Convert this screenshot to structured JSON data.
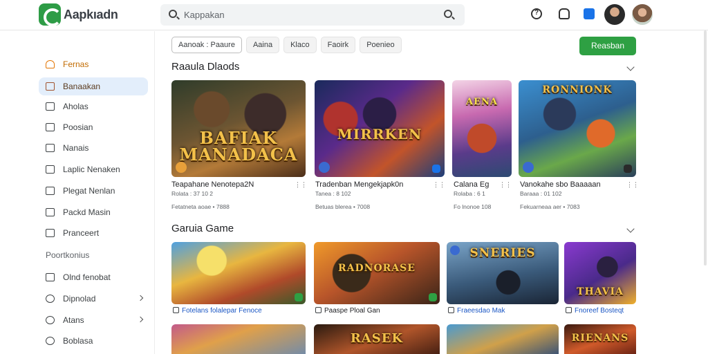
{
  "app": {
    "name": "Aapkıadn"
  },
  "search": {
    "placeholder": "Kappakan"
  },
  "sidebar": {
    "items": [
      {
        "label": "Fernas"
      },
      {
        "label": "Banaakan"
      },
      {
        "label": "Aholas"
      },
      {
        "label": "Poosian"
      },
      {
        "label": "Nanais"
      },
      {
        "label": "Laplic Nenaken"
      },
      {
        "label": "Plegat Nenlan"
      },
      {
        "label": "Packd Masin"
      },
      {
        "label": "Pranceert"
      }
    ],
    "section": "Poortkonius",
    "items2": [
      {
        "label": "Olnd fenobat"
      },
      {
        "label": "Dipnolad"
      },
      {
        "label": "Atans"
      },
      {
        "label": "Boblasa"
      }
    ]
  },
  "chips": [
    "Aanoak : Paaure",
    "Aaina",
    "Klaco",
    "Faoirk",
    "Poenieo"
  ],
  "cta": "Reasban",
  "section1": {
    "title": "Raaula Dlaods",
    "cards": [
      {
        "art": "BAFIAK MANADACA",
        "title": "Teapahane Nenotepa2N",
        "line2": "Rolata : 37 10 2",
        "line3": "Fetatneta aoae • 7888"
      },
      {
        "art": "MIRRKEN",
        "title": "Tradenban Mengekjapk0n",
        "line2": "Tanea : 8 102",
        "line3": "Betuas blerea • 7008"
      },
      {
        "art": "AENA",
        "title": "Calana Eg",
        "line2": "Rolaba : 6 1",
        "line3": "Fo lnonoe 108"
      },
      {
        "art": "RONNIONK",
        "title": "Vanokahe sbo Baaaaan",
        "line2": "Baraaa : 01 102",
        "line3": "Fekuarneaa aer • 7083"
      }
    ]
  },
  "section2": {
    "title": "Garuia Game",
    "cards": [
      {
        "art": "",
        "sub": "Fotelans folalepar Fenoce"
      },
      {
        "art": "RADNORASE",
        "sub": "Paaspe Ploal Gan"
      },
      {
        "art": "SNERIES",
        "sub": "Fraeesdao Mak"
      },
      {
        "art": "THAVIA",
        "sub": "Fnoreef Bosteqt"
      }
    ]
  },
  "section3": {
    "cards": [
      {
        "art": ""
      },
      {
        "art": "RASEK"
      },
      {
        "art": ""
      },
      {
        "art": "RIENANS"
      }
    ]
  }
}
